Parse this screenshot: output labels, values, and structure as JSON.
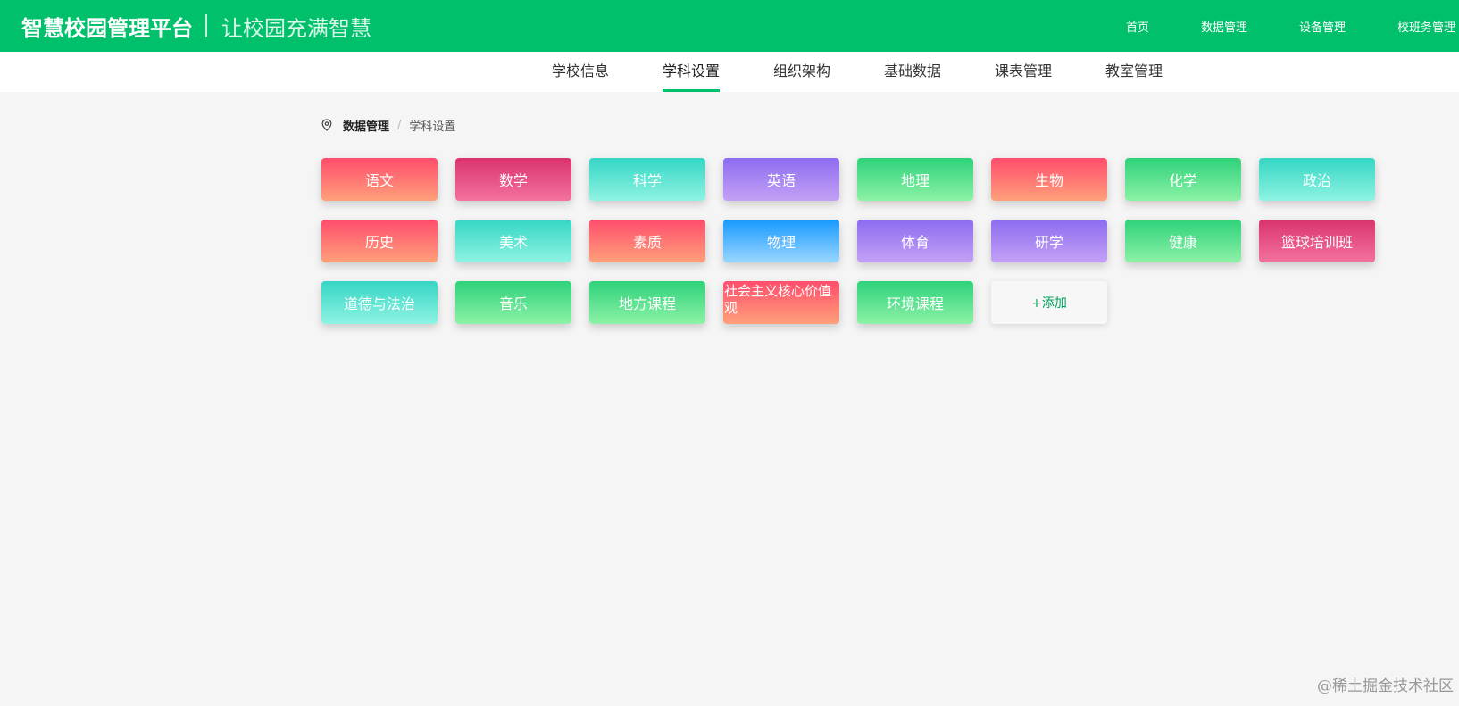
{
  "header": {
    "title": "智慧校园管理平台",
    "slogan": "让校园充满智慧",
    "nav": [
      "首页",
      "数据管理",
      "设备管理",
      "校班务管理"
    ]
  },
  "subnav": {
    "tabs": [
      "学校信息",
      "学科设置",
      "组织架构",
      "基础数据",
      "课表管理",
      "教室管理"
    ],
    "active": "学科设置"
  },
  "breadcrumb": {
    "icon": "location-pin-icon",
    "root": "数据管理",
    "separator": "/",
    "current": "学科设置"
  },
  "subjects": [
    {
      "name": "语文",
      "color": "red"
    },
    {
      "name": "数学",
      "color": "magenta"
    },
    {
      "name": "科学",
      "color": "teal"
    },
    {
      "name": "英语",
      "color": "purple"
    },
    {
      "name": "地理",
      "color": "green"
    },
    {
      "name": "生物",
      "color": "red"
    },
    {
      "name": "化学",
      "color": "green"
    },
    {
      "name": "政治",
      "color": "teal"
    },
    {
      "name": "历史",
      "color": "red"
    },
    {
      "name": "美术",
      "color": "teal"
    },
    {
      "name": "素质",
      "color": "red"
    },
    {
      "name": "物理",
      "color": "blue"
    },
    {
      "name": "体育",
      "color": "purple"
    },
    {
      "name": "研学",
      "color": "purple"
    },
    {
      "name": "健康",
      "color": "green"
    },
    {
      "name": "篮球培训班",
      "color": "magenta"
    },
    {
      "name": "道德与法治",
      "color": "teal"
    },
    {
      "name": "音乐",
      "color": "green"
    },
    {
      "name": "地方课程",
      "color": "green"
    },
    {
      "name": "社会主义核心价值观",
      "color": "red"
    },
    {
      "name": "环境课程",
      "color": "green"
    }
  ],
  "add_button": "+添加",
  "colors": {
    "brand": "#00c06b",
    "red": "#ff4d6d",
    "magenta": "#d9336e",
    "teal": "#35d6c4",
    "purple": "#8c6cf0",
    "green": "#2ed27a",
    "blue": "#1699ff"
  },
  "watermark": "@稀土掘金技术社区"
}
